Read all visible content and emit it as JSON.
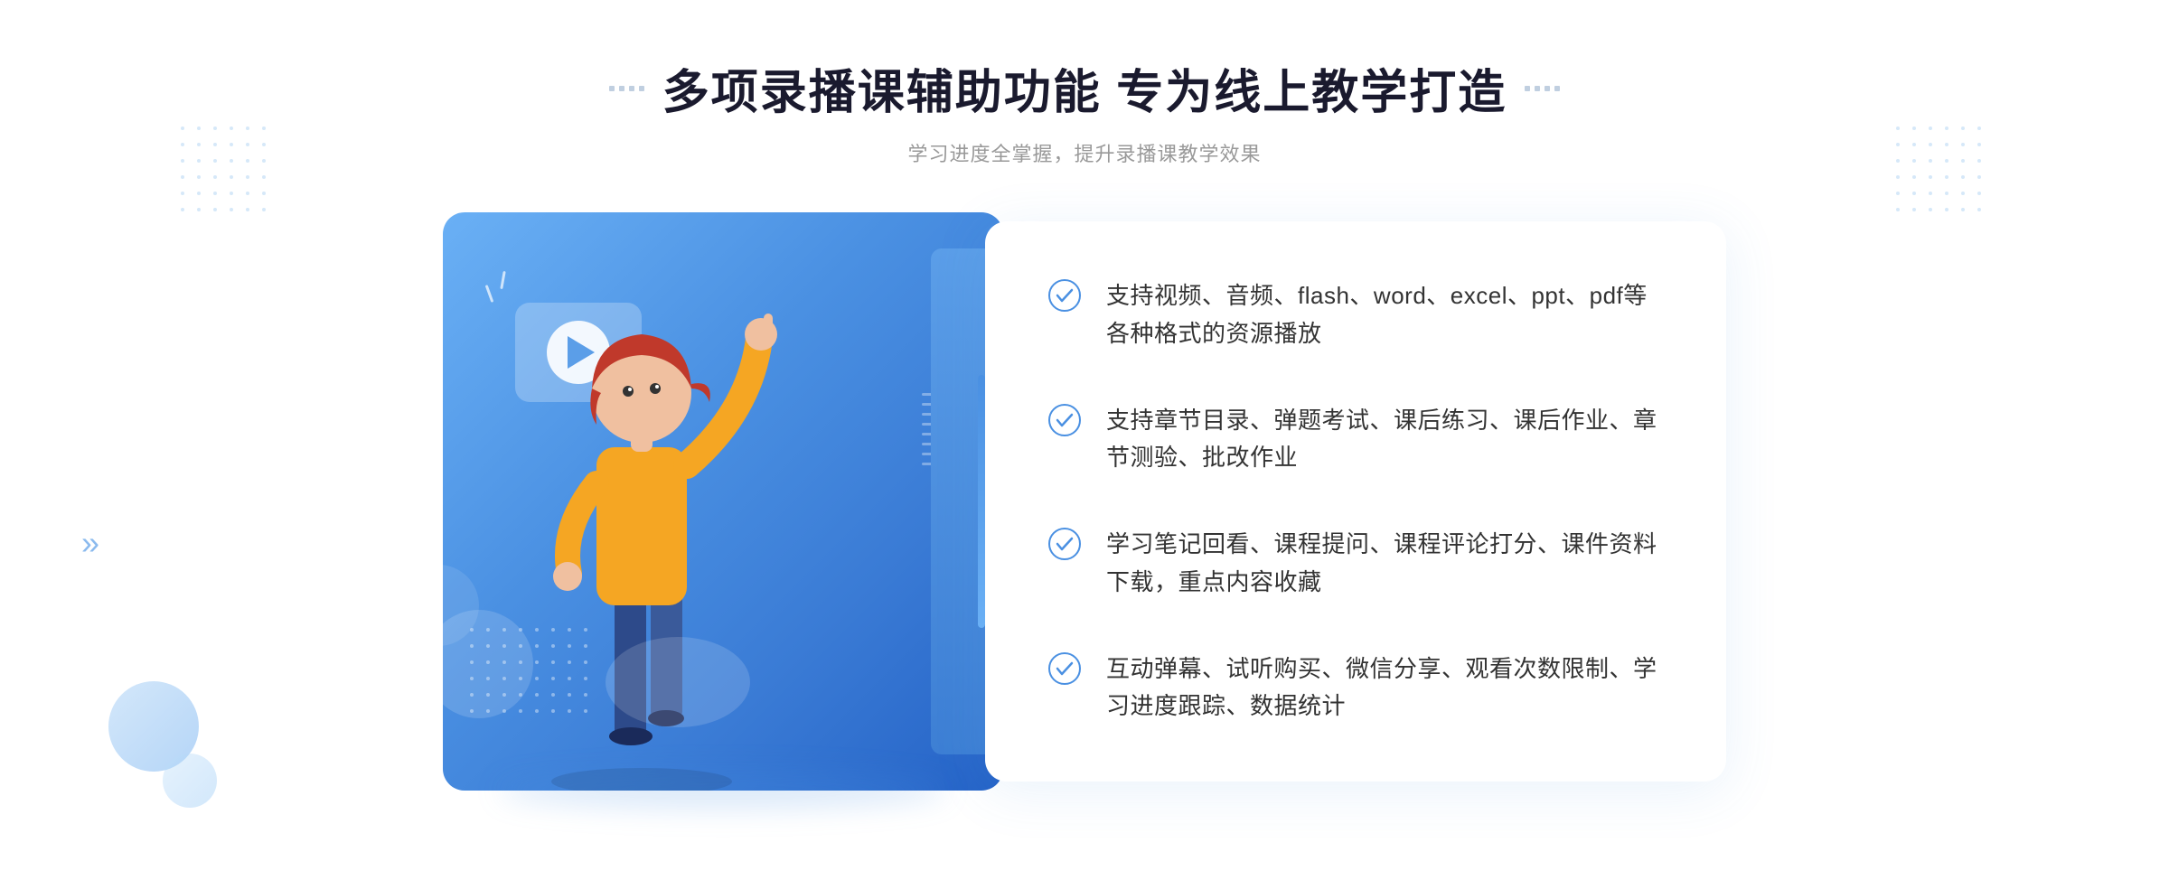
{
  "header": {
    "title": "多项录播课辅助功能 专为线上教学打造",
    "subtitle": "学习进度全掌握，提升录播课教学效果",
    "deco_left": "❖",
    "deco_right": "❖"
  },
  "features": [
    {
      "id": 1,
      "text": "支持视频、音频、flash、word、excel、ppt、pdf等各种格式的资源播放"
    },
    {
      "id": 2,
      "text": "支持章节目录、弹题考试、课后练习、课后作业、章节测验、批改作业"
    },
    {
      "id": 3,
      "text": "学习笔记回看、课程提问、课程评论打分、课件资料下载，重点内容收藏"
    },
    {
      "id": 4,
      "text": "互动弹幕、试听购买、微信分享、观看次数限制、学习进度跟踪、数据统计"
    }
  ],
  "colors": {
    "primary": "#4a90e2",
    "primary_dark": "#2563c7",
    "primary_light": "#6ab0f5",
    "text_dark": "#1a1a2e",
    "text_gray": "#999999",
    "text_feature": "#333333",
    "check_color": "#4a90e2",
    "bg_white": "#ffffff"
  }
}
